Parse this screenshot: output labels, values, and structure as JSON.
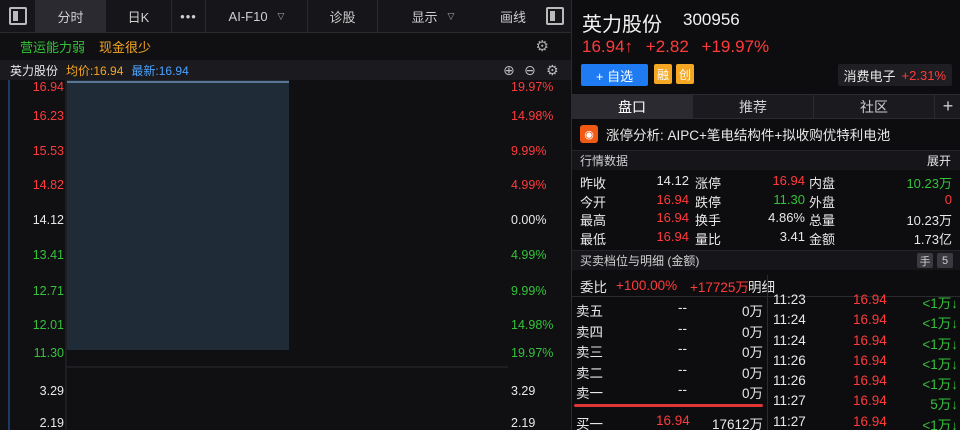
{
  "toolbar": {
    "fenshi": "分时",
    "rik": "日K",
    "more": "•••",
    "ai": "AI-F10",
    "zhengu": "诊股",
    "xianshi": "显示",
    "huaxian": "画线"
  },
  "tags": {
    "tag1": "营运能力弱",
    "tag2": "现金很少"
  },
  "infobar": {
    "name": "英力股份",
    "avg_label": "均价:16.94",
    "latest_label": "最新:16.94"
  },
  "chart": {
    "left_labels": [
      "16.94",
      "16.23",
      "15.53",
      "14.82",
      "14.12",
      "13.41",
      "12.71",
      "12.01",
      "11.30",
      "3.29",
      "2.19"
    ],
    "right_labels": [
      "19.97%",
      "14.98%",
      "9.99%",
      "4.99%",
      "0.00%",
      "4.99%",
      "9.99%",
      "14.98%",
      "19.97%",
      "3.29",
      "2.19"
    ],
    "colors": {
      "up": "#ff3b3b",
      "flat": "#e8e8e8",
      "down": "#35c23b",
      "area": "#1f2b36"
    }
  },
  "stock": {
    "name": "英力股份",
    "code": "300956",
    "price": "16.94↑",
    "change": "+2.82",
    "change_pct": "+19.97%",
    "add_btn": "+ 自选",
    "tag_rong": "融",
    "tag_chuang": "创",
    "sector": "消费电子",
    "sector_pct": "+2.31%"
  },
  "tabs": {
    "pankou": "盘口",
    "tuijian": "推荐",
    "shequ": "社区",
    "plus": "+"
  },
  "analysis": {
    "text": "涨停分析: AIPC+笔电结构件+拟收购优特利电池"
  },
  "quote_section": {
    "title": "行情数据",
    "expand": "展开",
    "rows": [
      {
        "l1": "昨收",
        "v1": "14.12",
        "l2": "涨停",
        "v2": "16.94",
        "l3": "内盘",
        "v3": "10.23万"
      },
      {
        "l1": "今开",
        "v1": "16.94",
        "l2": "跌停",
        "v2": "11.30",
        "l3": "外盘",
        "v3": "0"
      },
      {
        "l1": "最高",
        "v1": "16.94",
        "l2": "换手",
        "v2": "4.86%",
        "l3": "总量",
        "v3": "10.23万"
      },
      {
        "l1": "最低",
        "v1": "16.94",
        "l2": "量比",
        "v2": "3.41",
        "l3": "金额",
        "v3": "1.73亿"
      }
    ]
  },
  "book_section": {
    "title": "买卖档位与明细 (金额)",
    "hand": "手",
    "five": "5"
  },
  "order_head": {
    "weibi": "委比",
    "wb_pct": "+100.00%",
    "wb_amt": "+17725万",
    "mingxi": "明细"
  },
  "book": [
    {
      "label": "卖五",
      "price": "--",
      "amt": "0万"
    },
    {
      "label": "卖四",
      "price": "--",
      "amt": "0万"
    },
    {
      "label": "卖三",
      "price": "--",
      "amt": "0万"
    },
    {
      "label": "卖二",
      "price": "--",
      "amt": "0万"
    },
    {
      "label": "卖一",
      "price": "--",
      "amt": "0万"
    }
  ],
  "buy1": {
    "label": "买一",
    "price": "16.94",
    "amt": "17612万"
  },
  "ticks": [
    {
      "time": "11:23",
      "price": "16.94",
      "vol": "<1万↓"
    },
    {
      "time": "11:24",
      "price": "16.94",
      "vol": "<1万↓"
    },
    {
      "time": "11:24",
      "price": "16.94",
      "vol": "<1万↓"
    },
    {
      "time": "11:26",
      "price": "16.94",
      "vol": "<1万↓"
    },
    {
      "time": "11:26",
      "price": "16.94",
      "vol": "<1万↓"
    },
    {
      "time": "11:27",
      "price": "16.94",
      "vol": "5万↓"
    },
    {
      "time": "11:27",
      "price": "16.94",
      "vol": "<1万↓"
    }
  ]
}
